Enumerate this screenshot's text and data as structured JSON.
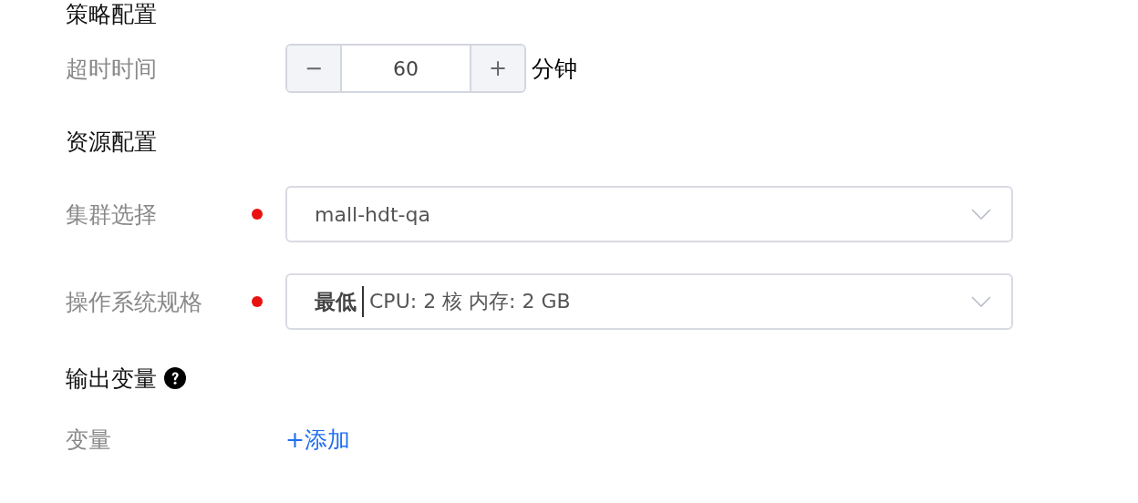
{
  "sections": [
    {
      "title": "策略配置",
      "help": false,
      "fields": [
        {
          "kind": "stepper",
          "label": "超时时间",
          "required": false,
          "decrement": "−",
          "value": "60",
          "increment": "+",
          "unit": "分钟"
        }
      ]
    },
    {
      "title": "资源配置",
      "help": false,
      "fields": [
        {
          "kind": "select",
          "label": "集群选择",
          "required": true,
          "value": "mall-hdt-qa"
        },
        {
          "kind": "select",
          "label": "操作系统规格",
          "required": true,
          "tag": "最低",
          "value": "CPU: 2 核 内存: 2 GB"
        }
      ]
    },
    {
      "title": "输出变量",
      "help": true,
      "fields": [
        {
          "kind": "link",
          "label": "变量",
          "required": false,
          "link": "+添加"
        }
      ]
    }
  ]
}
